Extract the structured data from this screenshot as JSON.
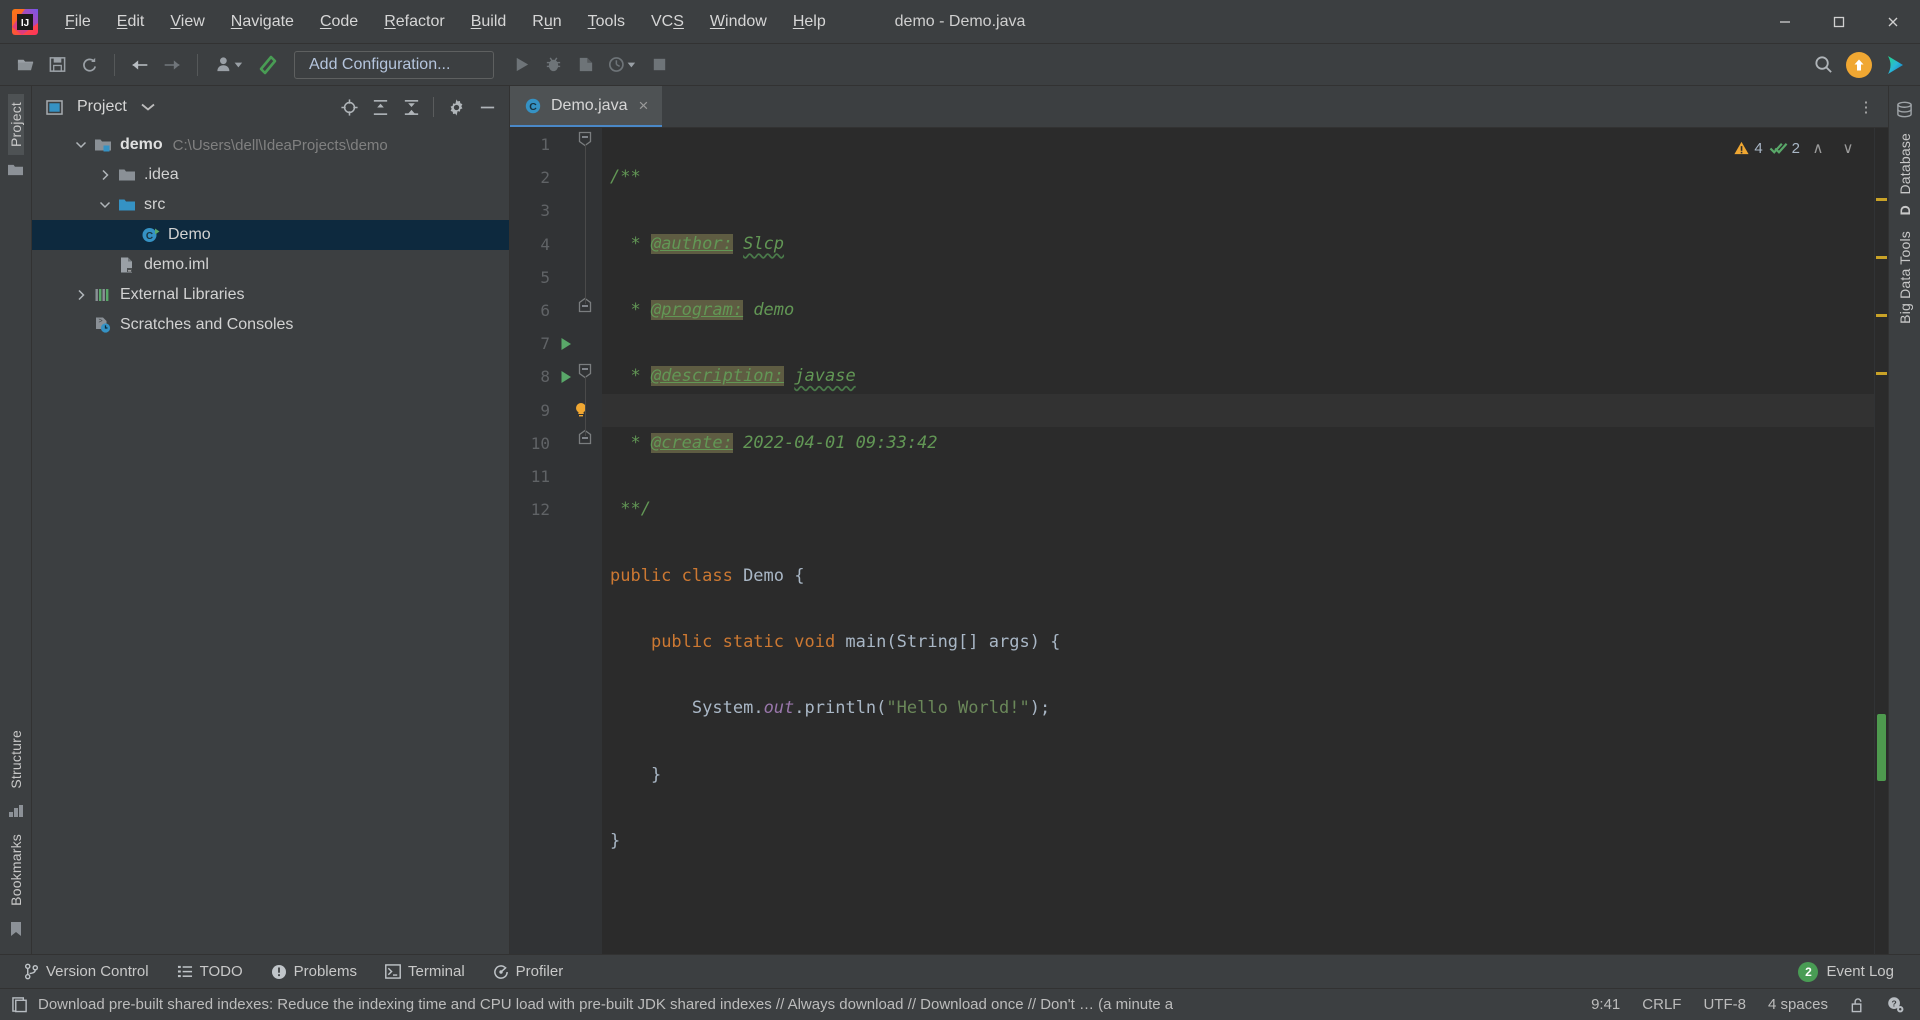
{
  "window": {
    "title": "demo - Demo.java",
    "minimize_label": "Minimize",
    "maximize_label": "Maximize",
    "close_label": "Close"
  },
  "menu": {
    "items": [
      {
        "label": "File",
        "mnemonic": "F"
      },
      {
        "label": "Edit",
        "mnemonic": "E"
      },
      {
        "label": "View",
        "mnemonic": "V"
      },
      {
        "label": "Navigate",
        "mnemonic": "N"
      },
      {
        "label": "Code",
        "mnemonic": "C"
      },
      {
        "label": "Refactor",
        "mnemonic": "R"
      },
      {
        "label": "Build",
        "mnemonic": "B"
      },
      {
        "label": "Run",
        "mnemonic": "u"
      },
      {
        "label": "Tools",
        "mnemonic": "T"
      },
      {
        "label": "VCS",
        "mnemonic": "S"
      },
      {
        "label": "Window",
        "mnemonic": "W"
      },
      {
        "label": "Help",
        "mnemonic": "H"
      }
    ]
  },
  "toolbar": {
    "open_label": "Open",
    "save_label": "Save All",
    "sync_label": "Synchronize",
    "back_label": "Back",
    "forward_label": "Forward",
    "profile_label": "Profile",
    "build_label": "Build Project",
    "configuration": "Add Configuration...",
    "run_label": "Run",
    "debug_label": "Debug",
    "coverage_label": "Run with Coverage",
    "profiler_label": "Profiler",
    "stop_label": "Stop",
    "search_label": "Search Everywhere",
    "update_label": "Update",
    "ide_run_label": "IDE Run"
  },
  "left_rail": {
    "labels": [
      "Project",
      "Structure",
      "Bookmarks"
    ]
  },
  "right_rail": {
    "labels": [
      "Database",
      "Big Data Tools"
    ],
    "bigdata_prefix": "D"
  },
  "project_panel": {
    "title": "Project",
    "tools": {
      "locate_label": "Select Opened File",
      "expand_label": "Expand All",
      "collapse_label": "Collapse All",
      "settings_label": "Settings",
      "hide_label": "Hide"
    },
    "tree": [
      {
        "label": "demo",
        "path": "C:\\Users\\dell\\IdeaProjects\\demo",
        "icon": "module-folder-icon",
        "state": "expanded",
        "indent": 1,
        "bold": true,
        "selected": false
      },
      {
        "label": ".idea",
        "path": "",
        "icon": "folder-icon",
        "state": "collapsed",
        "indent": 2,
        "bold": false,
        "selected": false
      },
      {
        "label": "src",
        "path": "",
        "icon": "source-folder-icon",
        "state": "expanded",
        "indent": 2,
        "bold": false,
        "selected": false
      },
      {
        "label": "Demo",
        "path": "",
        "icon": "java-class-runnable-icon",
        "state": "leaf",
        "indent": 3,
        "bold": false,
        "selected": true
      },
      {
        "label": "demo.iml",
        "path": "",
        "icon": "iml-file-icon",
        "state": "leaf",
        "indent": 2,
        "bold": false,
        "selected": false
      },
      {
        "label": "External Libraries",
        "path": "",
        "icon": "libraries-icon",
        "state": "collapsed",
        "indent": 1,
        "bold": false,
        "selected": false
      },
      {
        "label": "Scratches and Consoles",
        "path": "",
        "icon": "scratches-icon",
        "state": "leaf",
        "indent": 1,
        "bold": false,
        "selected": false
      }
    ]
  },
  "editor": {
    "tabs": [
      {
        "label": "Demo.java",
        "icon": "java-class-icon",
        "active": true,
        "close_label": "×"
      }
    ],
    "options_label": "⋮",
    "inspections": {
      "warning_count": "4",
      "warning_icon": "warning-triangle-icon",
      "ok_count": "2",
      "ok_icon": "green-checkmark-icon",
      "prev_label": "∧",
      "next_label": "∨"
    },
    "line_numbers": [
      "1",
      "2",
      "3",
      "4",
      "5",
      "6",
      "7",
      "8",
      "9",
      "10",
      "11",
      "12"
    ],
    "current_line": 9,
    "gutter_icons": [
      {
        "line": 7,
        "icon": "run-gutter-icon"
      },
      {
        "line": 8,
        "icon": "run-gutter-icon"
      },
      {
        "line": 9,
        "icon": "intention-bulb-icon"
      }
    ],
    "folds": [
      {
        "line": 1,
        "type": "fold-open"
      },
      {
        "line": 6,
        "type": "fold-end"
      },
      {
        "line": 8,
        "type": "fold-open"
      },
      {
        "line": 10,
        "type": "fold-end"
      }
    ],
    "code_lines": [
      {
        "n": 1,
        "tokens": [
          {
            "t": "/**",
            "c": "c-doc"
          }
        ]
      },
      {
        "n": 2,
        "tokens": [
          {
            "t": "  * ",
            "c": "c-doc"
          },
          {
            "t": "@author:",
            "c": "c-tag"
          },
          {
            "t": " ",
            "c": "c-doc"
          },
          {
            "t": "Slcp",
            "c": "c-doc squiggle"
          }
        ]
      },
      {
        "n": 3,
        "tokens": [
          {
            "t": "  * ",
            "c": "c-doc"
          },
          {
            "t": "@program:",
            "c": "c-tag"
          },
          {
            "t": " demo",
            "c": "c-doc"
          }
        ]
      },
      {
        "n": 4,
        "tokens": [
          {
            "t": "  * ",
            "c": "c-doc"
          },
          {
            "t": "@description:",
            "c": "c-tag"
          },
          {
            "t": " ",
            "c": "c-doc"
          },
          {
            "t": "javase",
            "c": "c-doc squiggle"
          }
        ]
      },
      {
        "n": 5,
        "tokens": [
          {
            "t": "  * ",
            "c": "c-doc"
          },
          {
            "t": "@create:",
            "c": "c-tag"
          },
          {
            "t": " 2022-04-01 09:33:42",
            "c": "c-doc"
          }
        ]
      },
      {
        "n": 6,
        "tokens": [
          {
            "t": " **/",
            "c": "c-doc"
          }
        ]
      },
      {
        "n": 7,
        "tokens": [
          {
            "t": "public class ",
            "c": "c-kw"
          },
          {
            "t": "Demo",
            "c": "c-cls"
          },
          {
            "t": " {",
            "c": "c-brace"
          }
        ]
      },
      {
        "n": 8,
        "tokens": [
          {
            "t": "    ",
            "c": "c-plain"
          },
          {
            "t": "public static void ",
            "c": "c-kw"
          },
          {
            "t": "main",
            "c": "c-fn"
          },
          {
            "t": "(",
            "c": "c-brace"
          },
          {
            "t": "String",
            "c": "c-cls"
          },
          {
            "t": "[] args) {",
            "c": "c-brace"
          }
        ]
      },
      {
        "n": 9,
        "tokens": [
          {
            "t": "        ",
            "c": "c-plain"
          },
          {
            "t": "System",
            "c": "c-cls"
          },
          {
            "t": ".",
            "c": "c-brace"
          },
          {
            "t": "out",
            "c": "c-static"
          },
          {
            "t": ".println(",
            "c": "c-plain"
          },
          {
            "t": "\"Hello World!\"",
            "c": "c-str"
          },
          {
            "t": ");",
            "c": "c-plain"
          }
        ]
      },
      {
        "n": 10,
        "tokens": [
          {
            "t": "    }",
            "c": "c-brace"
          }
        ]
      },
      {
        "n": 11,
        "tokens": [
          {
            "t": "}",
            "c": "c-brace"
          }
        ]
      },
      {
        "n": 12,
        "tokens": []
      }
    ],
    "scroll_markers": [
      {
        "top_pct": 8.5
      },
      {
        "top_pct": 15.5
      },
      {
        "top_pct": 22.5
      },
      {
        "top_pct": 29.5
      }
    ],
    "marker_color": "#c9a227"
  },
  "bottom_toolwindows": [
    {
      "label": "Version Control",
      "icon": "branch-icon"
    },
    {
      "label": "TODO",
      "icon": "list-icon"
    },
    {
      "label": "Problems",
      "icon": "exclamation-circle-icon"
    },
    {
      "label": "Terminal",
      "icon": "terminal-icon"
    },
    {
      "label": "Profiler",
      "icon": "profiler-icon"
    }
  ],
  "event_log": {
    "count": "2",
    "label": "Event Log"
  },
  "status_bar": {
    "message_icon": "notification-icon",
    "message": "Download pre-built shared indexes: Reduce the indexing time and CPU load with pre-built JDK shared indexes // Always download // Download once // Don't … (a minute a",
    "position": "9:41",
    "line_separator": "CRLF",
    "encoding": "UTF-8",
    "indent": "4 spaces",
    "lock_icon": "unlocked-padlock-icon",
    "help_icon": "help-config-icon"
  },
  "colors": {
    "background": "#3c3f41",
    "editor_bg": "#2b2b2b",
    "gutter_bg": "#313335",
    "selection": "#0d293e",
    "accent_blue": "#4a88c7",
    "keyword_orange": "#cc7832",
    "string_green": "#6a8759",
    "doc_green": "#629755",
    "tag_highlight": "#5e5c42",
    "static_purple": "#9876aa",
    "warning_yellow": "#f0a732",
    "success_green": "#499c54"
  }
}
